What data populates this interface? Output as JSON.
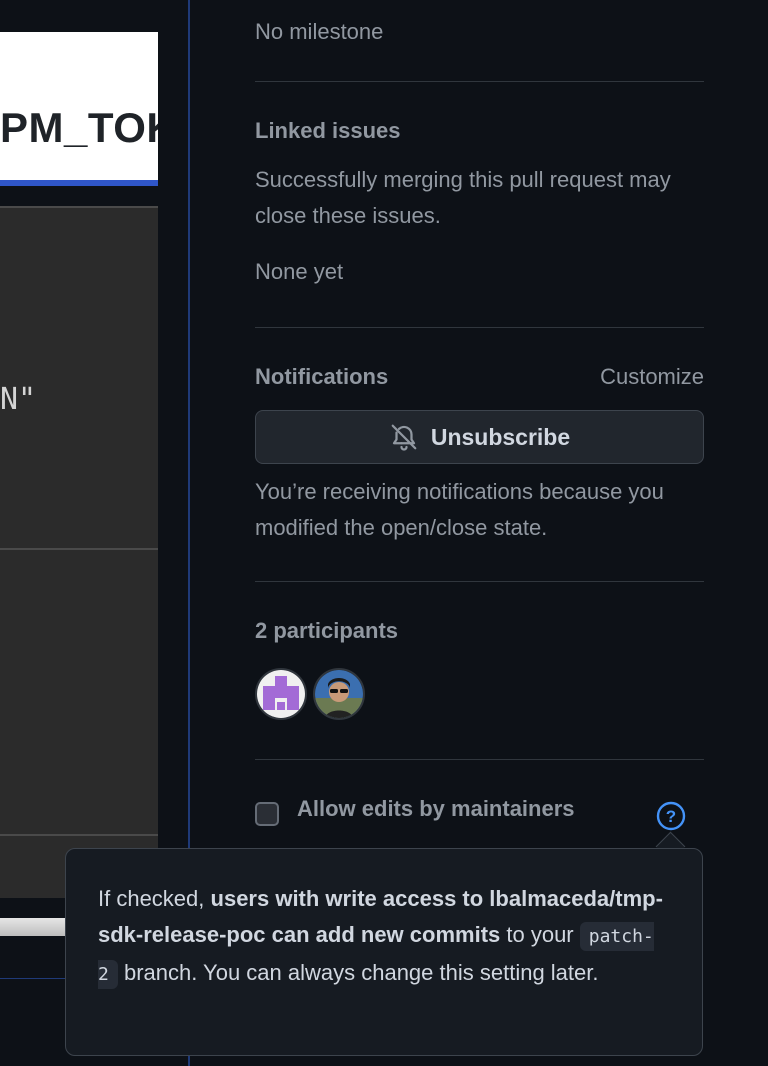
{
  "left": {
    "image_text": "PM_TOK",
    "code_text": "N\""
  },
  "sidebar": {
    "milestone": {
      "value": "No milestone"
    },
    "linked_issues": {
      "heading": "Linked issues",
      "description": "Successfully merging this pull request may close these issues.",
      "value": "None yet"
    },
    "notifications": {
      "heading": "Notifications",
      "customize_label": "Customize",
      "unsubscribe_label": "Unsubscribe",
      "note": "You’re receiving notifications because you modified the open/close state."
    },
    "participants": {
      "heading": "2 participants",
      "avatars": [
        "avatar-identicon",
        "avatar-photo"
      ]
    },
    "allow_edits": {
      "label": "Allow edits by maintainers",
      "checked": false
    }
  },
  "tooltip": {
    "prefix": "If checked, ",
    "bold": "users with write access to lbalmaceda/tmp-sdk-release-poc can add new commits",
    "mid": " to your ",
    "branch": "patch-2",
    "suffix": " branch. You can always change this setting later."
  },
  "colors": {
    "background": "#0d1117",
    "muted_text": "#9198a1",
    "accent_blue": "#4493f8",
    "divider": "#30363d"
  }
}
